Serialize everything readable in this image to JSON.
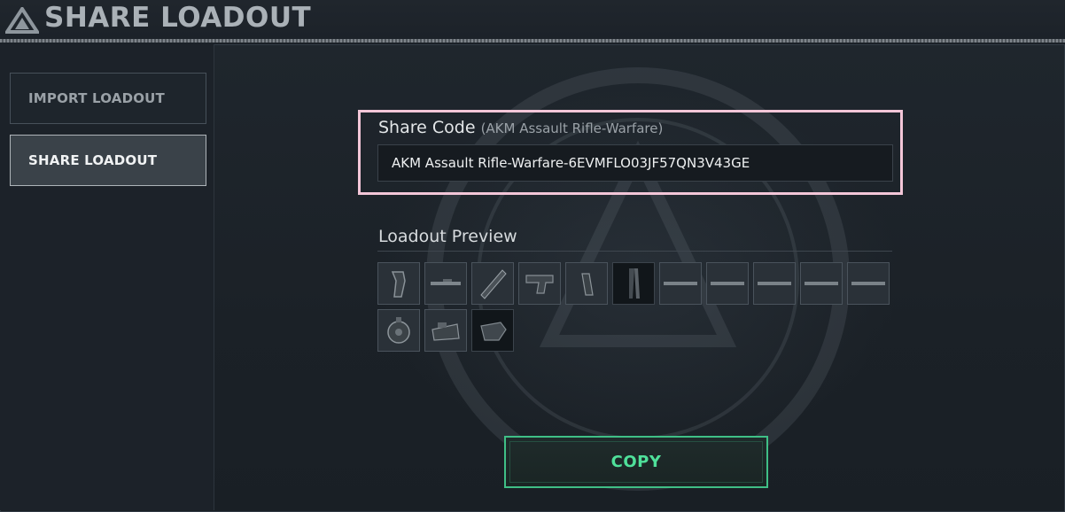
{
  "header": {
    "title": "SHARE LOADOUT"
  },
  "sidebar": {
    "items": [
      {
        "label": "IMPORT LOADOUT",
        "active": false
      },
      {
        "label": "SHARE LOADOUT",
        "active": true
      }
    ]
  },
  "share": {
    "label": "Share Code",
    "weapon_name": "(AKM Assault Rifle-Warfare)",
    "code": "AKM Assault Rifle-Warfare-6EVMFLO03JF57QN3V43GE"
  },
  "preview": {
    "title": "Loadout Preview",
    "slots": [
      {
        "icon": "grip-icon"
      },
      {
        "icon": "barrel-icon"
      },
      {
        "icon": "handguard-icon"
      },
      {
        "icon": "stock-icon"
      },
      {
        "icon": "pistol-grip-icon"
      },
      {
        "icon": "mount-rail-icon",
        "selected": true
      },
      {
        "icon": "rail-icon"
      },
      {
        "icon": "rail-icon"
      },
      {
        "icon": "rail-icon"
      },
      {
        "icon": "rail-icon"
      },
      {
        "icon": "rail-icon"
      },
      {
        "icon": "drum-magazine-icon"
      },
      {
        "icon": "optic-sight-icon"
      },
      {
        "icon": "foregrip-icon",
        "selected": true
      }
    ]
  },
  "actions": {
    "copy_label": "COPY"
  },
  "colors": {
    "accent": "#4fe09a",
    "highlight_border": "#f3c6d8",
    "background": "#1b2128"
  }
}
